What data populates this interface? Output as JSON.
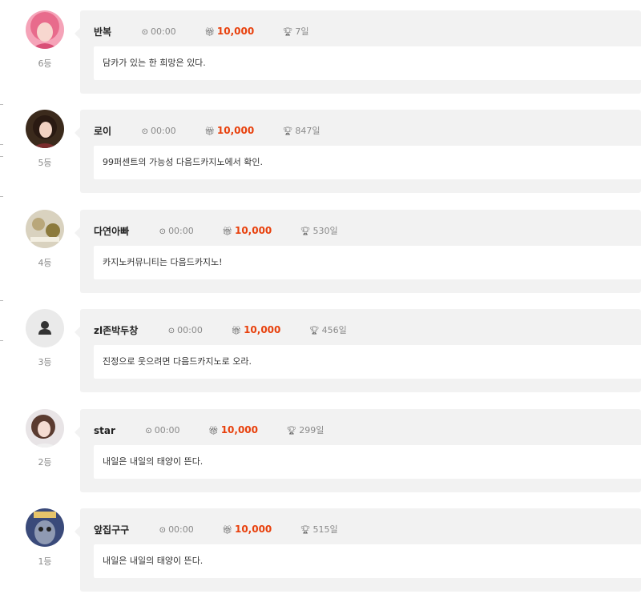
{
  "entries": [
    {
      "rank": "6등",
      "nickname": "반복",
      "time": "00:00",
      "points": "10,000",
      "days": "7일",
      "message": "담카가 있는 한 희망은 있다.",
      "avatar_icon": "avatar-photo"
    },
    {
      "rank": "5등",
      "nickname": "로이",
      "time": "00:00",
      "points": "10,000",
      "days": "847일",
      "message": "99퍼센트의 가능성 다음드카지노에서 확인.",
      "avatar_icon": "avatar-photo"
    },
    {
      "rank": "4등",
      "nickname": "다연아빠",
      "time": "00:00",
      "points": "10,000",
      "days": "530일",
      "message": "카지노커뮤니티는 다음드카지노!",
      "avatar_icon": "avatar-photo"
    },
    {
      "rank": "3등",
      "nickname": "zl존박두창",
      "time": "00:00",
      "points": "10,000",
      "days": "456일",
      "message": "진정으로 웃으려면 다음드카지노로 오라.",
      "avatar_icon": "default-user-icon"
    },
    {
      "rank": "2등",
      "nickname": "star",
      "time": "00:00",
      "points": "10,000",
      "days": "299일",
      "message": "내일은 내일의 태양이 뜬다.",
      "avatar_icon": "avatar-photo"
    },
    {
      "rank": "1등",
      "nickname": "앞집구구",
      "time": "00:00",
      "points": "10,000",
      "days": "515일",
      "message": "내일은 내일의 태양이 뜬다.",
      "avatar_icon": "avatar-photo"
    }
  ],
  "icons": {
    "time": "clock-icon",
    "points": "gift-icon",
    "days": "trophy-icon"
  },
  "colors": {
    "points": "#e8400c",
    "card_bg": "#f2f2f2",
    "rank_text": "#8a8a8a"
  }
}
